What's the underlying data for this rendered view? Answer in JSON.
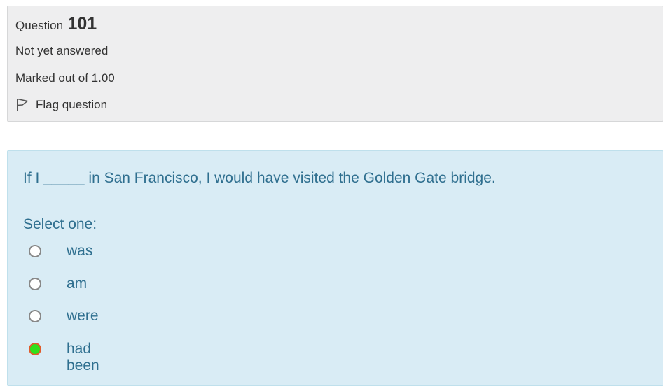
{
  "info": {
    "question_label": "Question",
    "question_number": "101",
    "state": "Not yet answered",
    "grade": "Marked out of 1.00",
    "flag_label": "Flag question",
    "flag_icon": "flag-icon"
  },
  "formulation": {
    "question_text": "If I _____ in San Francisco, I would have visited the Golden Gate bridge.",
    "prompt": "Select one:",
    "options": [
      {
        "label": "was",
        "selected": false
      },
      {
        "label": "am",
        "selected": false
      },
      {
        "label": "were",
        "selected": false
      },
      {
        "label": "had been",
        "selected": true
      }
    ]
  },
  "colors": {
    "info_background": "#eeeeef",
    "formulation_background": "#d9ecf5",
    "formulation_text": "#2f6f8f",
    "selected_radio_fill": "#2fe01a",
    "selected_radio_border": "#e05b2b"
  }
}
